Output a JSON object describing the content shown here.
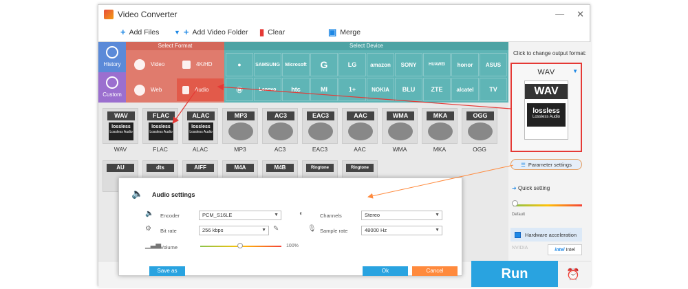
{
  "app": {
    "title": "Video Converter",
    "window_controls": [
      "—",
      "✕"
    ]
  },
  "toolbar": {
    "add_files": "Add Files",
    "add_video_folder": "Add Video Folder",
    "clear": "Clear",
    "merge": "Merge"
  },
  "categories": {
    "history": "History",
    "custom": "Custom"
  },
  "format_section": {
    "header": "Select Format",
    "items": [
      "Video",
      "4K/HD",
      "Web",
      "Audio"
    ]
  },
  "device_section": {
    "header": "Select Device",
    "row1": [
      "",
      "SAMSUNG",
      "Microsoft",
      "G",
      "LG",
      "amazon",
      "SONY",
      "HUAWEI",
      "honor",
      "ASUS"
    ],
    "row2": [
      "",
      "Lenovo",
      "htc",
      "MI",
      "1+",
      "NOKIA",
      "BLU",
      "ZTE",
      "alcatel",
      "TV"
    ]
  },
  "audio_formats": {
    "row1": [
      "WAV",
      "FLAC",
      "ALAC",
      "MP3",
      "AC3",
      "EAC3",
      "AAC",
      "WMA",
      "MKA",
      "OGG"
    ],
    "lossless_label": "Lossless Audio",
    "lossless_brand": "lossless",
    "row2": [
      "AU",
      "dts",
      "AIFF",
      "M4A",
      "M4B",
      "Ringtone",
      "Ringtone"
    ]
  },
  "right": {
    "click_label": "Click to change output format:",
    "output_format": "WAV",
    "param_settings": "Parameter settings",
    "quick_setting": "Quick setting",
    "default_label": "Default",
    "hw_accel": "Hardware acceleration",
    "nvidia": "NVIDIA",
    "intel": "Intel",
    "intel_logo": "intel",
    "run": "Run"
  },
  "audio_settings": {
    "title": "Audio settings",
    "encoder_label": "Encoder",
    "encoder_value": "PCM_S16LE",
    "bitrate_label": "Bit rate",
    "bitrate_value": "256 kbps",
    "volume_label": "Volume",
    "volume_percent": "100%",
    "channels_label": "Channels",
    "channels_value": "Stereo",
    "samplerate_label": "Sample rate",
    "samplerate_value": "48000 Hz",
    "save_as": "Save as",
    "ok": "Ok",
    "cancel": "Cancel"
  },
  "colors": {
    "accent": "#29a3e0",
    "highlight": "#e53935",
    "callout": "#ff8a3d"
  }
}
